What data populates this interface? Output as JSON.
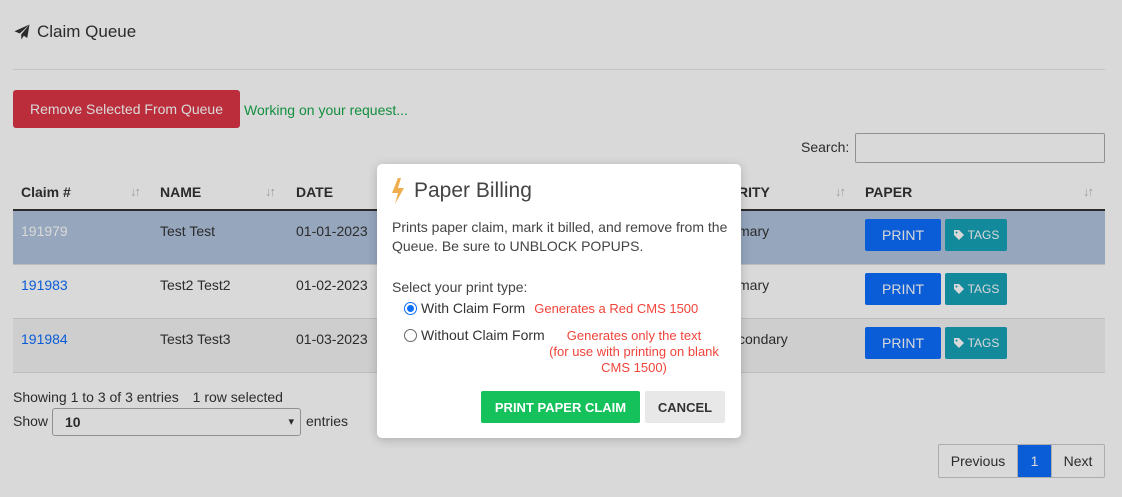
{
  "page": {
    "title": "Claim Queue",
    "remove_button": "Remove Selected From Queue",
    "status": "Working on your request...",
    "search_label": "Search:",
    "search_value": ""
  },
  "table": {
    "columns": [
      "Claim #",
      "NAME",
      "DATE",
      "RITY",
      "PAPER"
    ],
    "rows": [
      {
        "claim": "191979",
        "name": "Test Test",
        "date": "01-01-2023",
        "priority": "mary",
        "print": "PRINT",
        "tags": "TAGS",
        "selected": true
      },
      {
        "claim": "191983",
        "name": "Test2 Test2",
        "date": "01-02-2023",
        "priority": "mary",
        "print": "PRINT",
        "tags": "TAGS",
        "selected": false
      },
      {
        "claim": "191984",
        "name": "Test3 Test3",
        "date": "01-03-2023",
        "priority": "condary",
        "print": "PRINT",
        "tags": "TAGS",
        "selected": false
      }
    ]
  },
  "footer": {
    "info": "Showing 1 to 3 of 3 entries",
    "selected_info": "1 row selected",
    "show_label": "Show",
    "show_value": "10",
    "entries_label": "entries",
    "pagination": {
      "previous": "Previous",
      "current": "1",
      "next": "Next"
    }
  },
  "modal": {
    "title": "Paper Billing",
    "icon": "lightning-bolt-icon",
    "description": "Prints paper claim, mark it billed, and remove from the Queue. Be sure to UNBLOCK POPUPS.",
    "prompt": "Select your print type:",
    "option1_label": "With Claim Form",
    "option1_note": "Generates a Red CMS 1500",
    "option2_label": "Without Claim Form",
    "option2_note_line1": "Generates only the text",
    "option2_note_line2": "(for use with printing on blank",
    "option2_note_line3": "CMS 1500)",
    "selected_option": "With Claim Form",
    "confirm_button": "PRINT PAPER CLAIM",
    "cancel_button": "CANCEL"
  },
  "colors": {
    "remove_button": "#dc3545",
    "status_text": "#17a84b",
    "print_button": "#0d6efd",
    "tags_button": "#17a2b8",
    "confirm_button": "#14c15b",
    "note_text": "#f0443a",
    "selected_row": "#b0c4de"
  }
}
